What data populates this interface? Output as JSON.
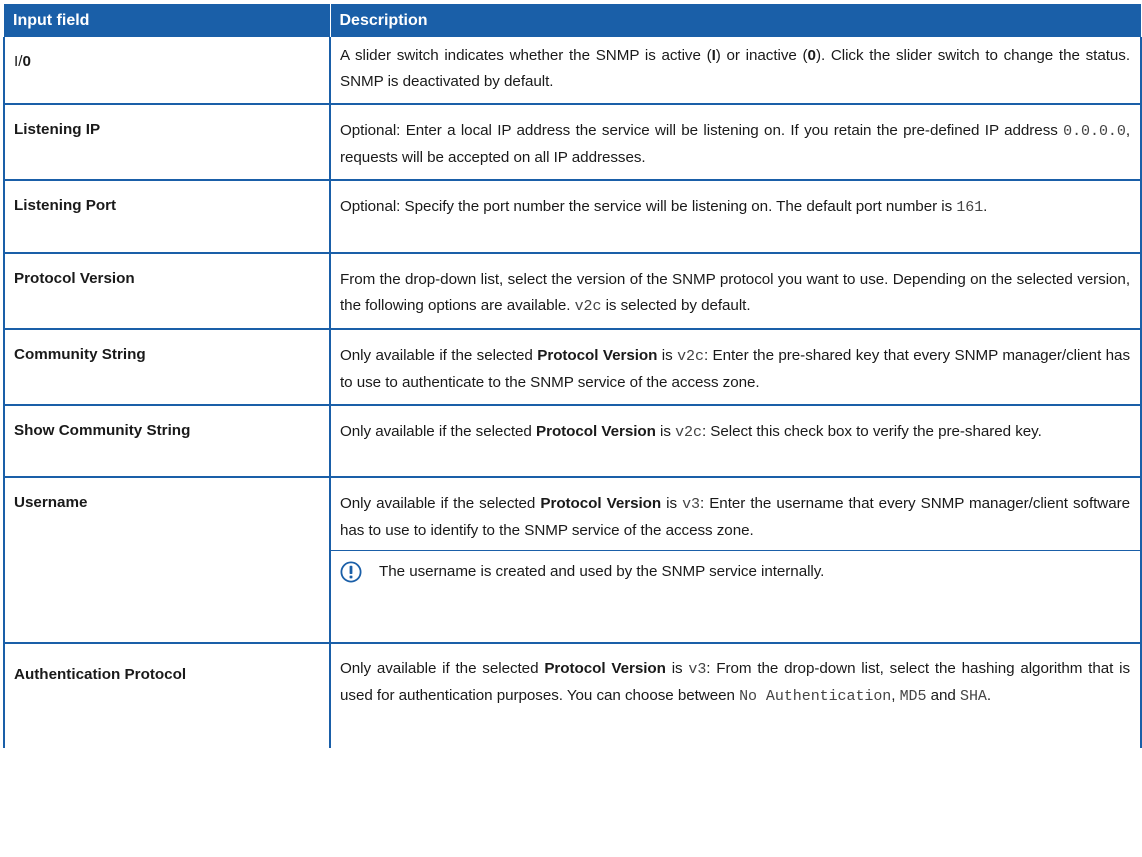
{
  "table": {
    "header": {
      "col1": "Input field",
      "col2": "Description"
    },
    "rows": [
      {
        "field_a": "I/",
        "field_b": "0",
        "d1": "A slider switch indicates whether the SNMP is active (",
        "d2": "I",
        "d3": ") or inactive (",
        "d4": "0",
        "d5": "). Click the slider switch to change the status. SNMP is deactivated by default."
      },
      {
        "field": "Listening IP",
        "d1": "Optional: Enter a local IP address the service will be listening on. If you retain the pre-defined IP address ",
        "d2": "0.0.0.0",
        "d3": ", requests will be accepted on all IP addresses."
      },
      {
        "field": "Listening Port",
        "d1": "Optional: Specify the port number the service will be listening on. The default port number is ",
        "d2": "161",
        "d3": "."
      },
      {
        "field": "Protocol Version",
        "d1": "From the drop-down list, select the version of the SNMP protocol you want to use. Depending on the selected version, the following options are available. ",
        "d2": "v2c",
        "d3": " is selected by default."
      },
      {
        "field": "Community String",
        "d1": "Only available if the selected ",
        "d2": "Protocol Version",
        "d3": " is ",
        "d4": "v2c",
        "d5": ": Enter the pre-shared key that every SNMP manager/client has to use to authenticate to the SNMP service of the access zone."
      },
      {
        "field": "Show Community String",
        "d1": "Only available if the selected ",
        "d2": "Protocol Version",
        "d3": " is ",
        "d4": "v2c",
        "d5": ": Select this check box to verify the pre-shared key."
      },
      {
        "field": "Username",
        "d1": "Only available if the selected ",
        "d2": "Protocol Version",
        "d3": " is ",
        "d4": "v3",
        "d5": ": Enter the username that every SNMP manager/client software has to use to identify to the SNMP service of the access zone.",
        "note": "The username is created and used by the SNMP service internally."
      },
      {
        "field": "Authentication Protocol",
        "d1": "Only available if the selected ",
        "d2": "Protocol Version",
        "d3": " is ",
        "d4": "v3",
        "d5": ": From the drop-down list, select the hashing algorithm that is used for authentication purposes. You can choose between ",
        "d6": "No Authentication",
        "d7": ", ",
        "d8": "MD5",
        "d9": " and ",
        "d10": "SHA",
        "d11": "."
      }
    ]
  },
  "icons": {
    "note": "exclamation-circle-icon"
  },
  "colors": {
    "header_bg": "#1a5fa8",
    "border": "#1a5fa8",
    "note_icon": "#1a5fa8"
  }
}
